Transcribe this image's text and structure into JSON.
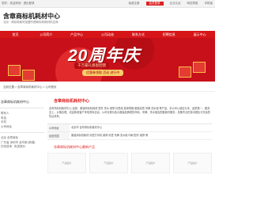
{
  "topbar": {
    "left": "您好，欢迎来到 · 退出登录",
    "right": [
      "免费注册",
      "会员登录",
      "企业认证",
      "网站导航",
      "手机版"
    ]
  },
  "header": {
    "title": "含章商标机耗材中心",
    "subtitle": "北京 · 商标机耗材加盟代理商标机耗材供应商"
  },
  "nav": [
    "首页",
    "公司简介",
    "产品中心",
    "公司动态",
    "联系方式",
    "招聘信息",
    "展示中心"
  ],
  "banner": {
    "headline": "20周年庆",
    "sub": "千万豪礼感恩回馈",
    "btn": "优惠券领取 活动 进行中"
  },
  "breadcrumb": "当前位置 > 含章商标机耗材中心 > 公司首页",
  "sidebar": {
    "title": "含章商标机耗材中心",
    "lines": [
      "联系人",
      "电话",
      "手机",
      "公司地址"
    ],
    "more": [
      "北京 含章商标",
      "广东省 深圳市 龙华新 [新增]",
      "在线咨询 · 批发报价"
    ]
  },
  "main": {
    "title": "含章商标机耗材中心",
    "para": "含章商标机耗材中心 经营：服装商标机耗材 配件 墨水 碳带 标签纸 各种规格 服装标签 吊牌 洗水唛 等产品，本公司以诚信为本，品质第一，服务至上，价格合理，欢迎新老客户来电咨询洽谈。公司长期为各大服装品牌提供商标、吊牌、洗水唛及配套耗材服务，具备专业的技术团队与完善的售后体系。",
    "info": [
      {
        "k": "公司地址",
        "v": "北京市 含章商标机耗材中心"
      },
      {
        "k": "经营范围",
        "v": "服装商标机耗材 标签打印机 碳带 标签 吊牌 洗水唛 印刷 配件 维修 等"
      }
    ],
    "products_title": "含章商标机耗材中心最新产品",
    "products": [
      "产品图片",
      "产品图片",
      "产品图片",
      "产品图片"
    ]
  },
  "colors": {
    "brand_red": "#d61518",
    "banner_red": "#c8101a"
  }
}
